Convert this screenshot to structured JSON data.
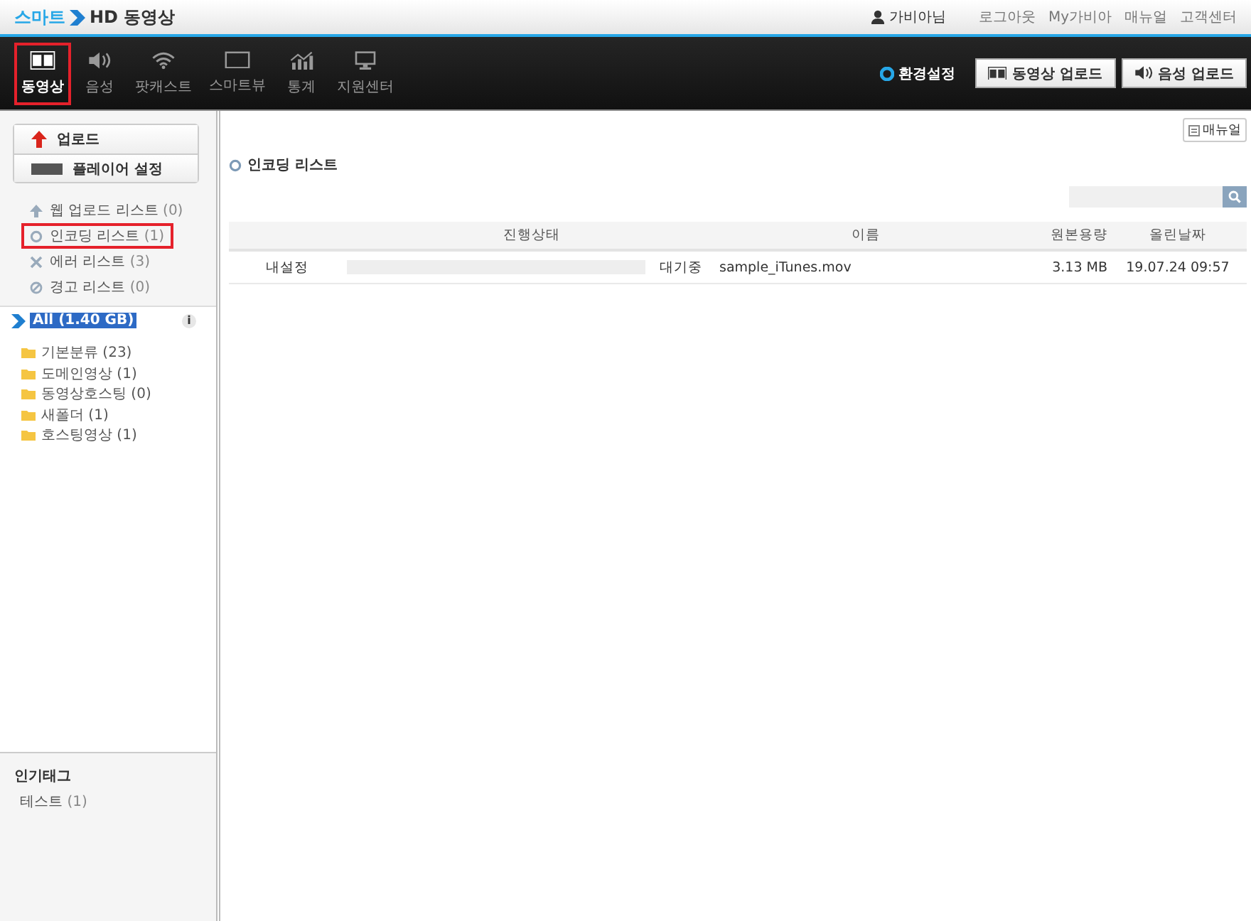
{
  "header": {
    "logo_prefix": "스마트",
    "logo_suffix": "HD 동영상",
    "user": "가비아님",
    "links": [
      "로그아웃",
      "My가비아",
      "매뉴얼",
      "고객센터"
    ]
  },
  "nav": {
    "items": [
      {
        "label": "동영상",
        "kind": "film",
        "selected": true
      },
      {
        "label": "음성",
        "kind": "speaker",
        "selected": false
      },
      {
        "label": "팟캐스트",
        "kind": "wifi",
        "selected": false
      },
      {
        "label": "스마트뷰",
        "kind": "screen",
        "selected": false
      },
      {
        "label": "통계",
        "kind": "chart",
        "selected": false
      },
      {
        "label": "지원센터",
        "kind": "monitor",
        "selected": false
      }
    ],
    "settings": "환경설정",
    "buttons": [
      {
        "label": "동영상 업로드",
        "kind": "film"
      },
      {
        "label": "음성 업로드",
        "kind": "speaker"
      }
    ]
  },
  "sidebar": {
    "actions": [
      {
        "label": "업로드",
        "kind": "arrow"
      },
      {
        "label": "플레이어 설정",
        "kind": "player"
      }
    ],
    "lists": [
      {
        "label": "웹 업로드 리스트",
        "count": "(0)",
        "kind": "up",
        "selected": false
      },
      {
        "label": "인코딩 리스트",
        "count": "(1)",
        "kind": "ring",
        "selected": true
      },
      {
        "label": "에러 리스트",
        "count": "(3)",
        "kind": "x",
        "selected": false
      },
      {
        "label": "경고 리스트",
        "count": "(0)",
        "kind": "ban",
        "selected": false
      }
    ],
    "tree": [
      {
        "label": "All (1.40 GB)",
        "info": "i",
        "selected": true,
        "children": [
          {
            "label": "기본분류 (23)",
            "selected": false
          },
          {
            "label": "도메인영상 (1)",
            "selected": false
          },
          {
            "label": "동영상호스팅 (0)",
            "selected": false
          },
          {
            "label": "새폴더 (1)",
            "selected": false
          },
          {
            "label": "호스팅영상 (1)",
            "selected": false
          }
        ]
      }
    ],
    "tags_title": "인기태그",
    "tags": [
      {
        "label": "테스트",
        "count": "(1)"
      }
    ]
  },
  "main": {
    "manual_button": "매뉴얼",
    "title": "인코딩 리스트",
    "table": {
      "columns": [
        "진행상태",
        "이름",
        "원본용량",
        "올린날짜"
      ],
      "rows": [
        {
          "setting": "내설정",
          "level": 0,
          "status": "대기중",
          "name": "sample_iTunes.mov",
          "size": "3.13 MB",
          "date": "19.07.24 09:57"
        }
      ]
    }
  }
}
